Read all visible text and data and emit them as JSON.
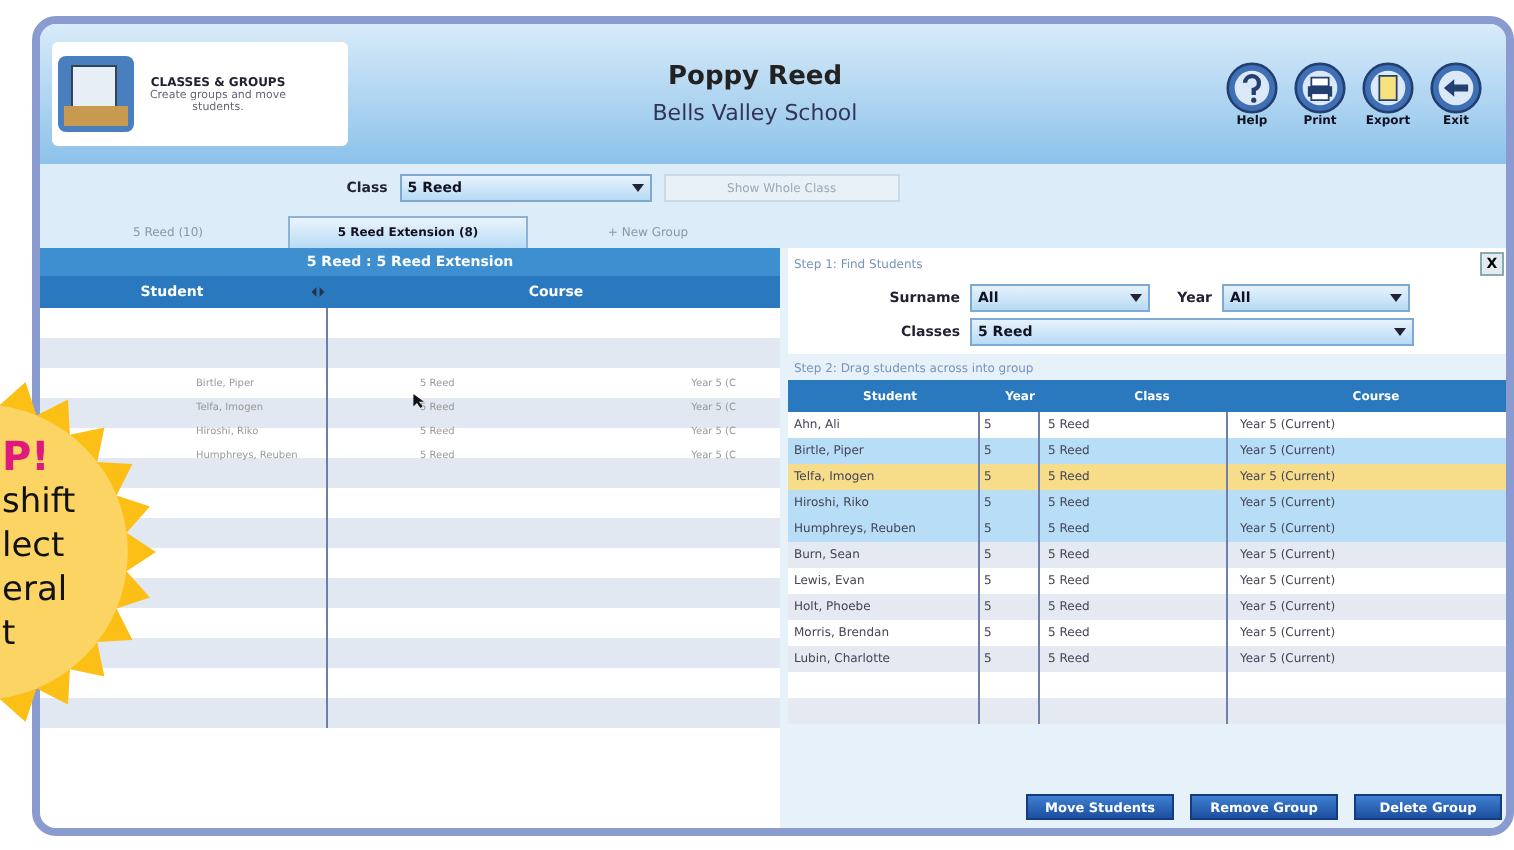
{
  "header": {
    "app_title": "CLASSES & GROUPS",
    "app_subtitle": "Create groups and move students.",
    "user_name": "Poppy Reed",
    "school": "Bells Valley School",
    "tools": [
      {
        "kind": "help",
        "label": "Help"
      },
      {
        "kind": "print",
        "label": "Print"
      },
      {
        "kind": "export",
        "label": "Export"
      },
      {
        "kind": "exit",
        "label": "Exit"
      }
    ]
  },
  "class_bar": {
    "label": "Class",
    "value": "5 Reed",
    "button": {
      "label": "Show Whole Class",
      "disabled": true
    }
  },
  "tabs": [
    {
      "label": "5 Reed (10)",
      "selected": false
    },
    {
      "label": "5 Reed Extension (8)",
      "selected": true
    },
    {
      "label": "+ New Group",
      "selected": false
    }
  ],
  "group_panel": {
    "title": "5 Reed : 5 Reed Extension",
    "columns": [
      "Student",
      "Course"
    ],
    "dragging_rows": [
      {
        "student": "Birtle, Piper",
        "class": "5 Reed",
        "course": "Year 5 (C"
      },
      {
        "student": "Telfa, Imogen",
        "class": "5 Reed",
        "course": "Year 5 (C"
      },
      {
        "student": "Hiroshi, Riko",
        "class": "5 Reed",
        "course": "Year 5 (C"
      },
      {
        "student": "Humphreys, Reuben",
        "class": "5 Reed",
        "course": "Year 5 (C"
      }
    ]
  },
  "find_panel": {
    "step1": "Step 1: Find Students",
    "close": "X",
    "filters": [
      {
        "label": "Surname",
        "value": "All"
      },
      {
        "label": "Year",
        "value": "All"
      },
      {
        "label": "Classes",
        "value": "5 Reed"
      }
    ],
    "step2": "Step 2: Drag students across into group",
    "columns": [
      "Student",
      "Year",
      "Class",
      "Course"
    ],
    "rows": [
      {
        "student": "Ahn, Ali",
        "year": "5",
        "class": "5 Reed",
        "course": "Year 5 (Current)",
        "selected": false,
        "dragging": false
      },
      {
        "student": "Birtle, Piper",
        "year": "5",
        "class": "5 Reed",
        "course": "Year 5 (Current)",
        "selected": true,
        "dragging": false
      },
      {
        "student": "Telfa, Imogen",
        "year": "5",
        "class": "5 Reed",
        "course": "Year 5 (Current)",
        "selected": true,
        "dragging": true
      },
      {
        "student": "Hiroshi, Riko",
        "year": "5",
        "class": "5 Reed",
        "course": "Year 5 (Current)",
        "selected": true,
        "dragging": false
      },
      {
        "student": "Humphreys, Reuben",
        "year": "5",
        "class": "5 Reed",
        "course": "Year 5 (Current)",
        "selected": true,
        "dragging": false
      },
      {
        "student": "Burn, Sean",
        "year": "5",
        "class": "5 Reed",
        "course": "Year 5 (Current)",
        "selected": false,
        "dragging": false
      },
      {
        "student": "Lewis, Evan",
        "year": "5",
        "class": "5 Reed",
        "course": "Year 5 (Current)",
        "selected": false,
        "dragging": false
      },
      {
        "student": "Holt, Phoebe",
        "year": "5",
        "class": "5 Reed",
        "course": "Year 5 (Current)",
        "selected": false,
        "dragging": false
      },
      {
        "student": "Morris, Brendan",
        "year": "5",
        "class": "5 Reed",
        "course": "Year 5 (Current)",
        "selected": false,
        "dragging": false
      },
      {
        "student": "Lubin, Charlotte",
        "year": "5",
        "class": "5 Reed",
        "course": "Year 5 (Current)",
        "selected": false,
        "dragging": false
      }
    ],
    "buttons": [
      "Move Students",
      "Remove Group",
      "Delete Group"
    ]
  },
  "tip": {
    "heading": "P!",
    "lines": [
      "shift",
      "lect",
      "eral",
      "t"
    ]
  }
}
